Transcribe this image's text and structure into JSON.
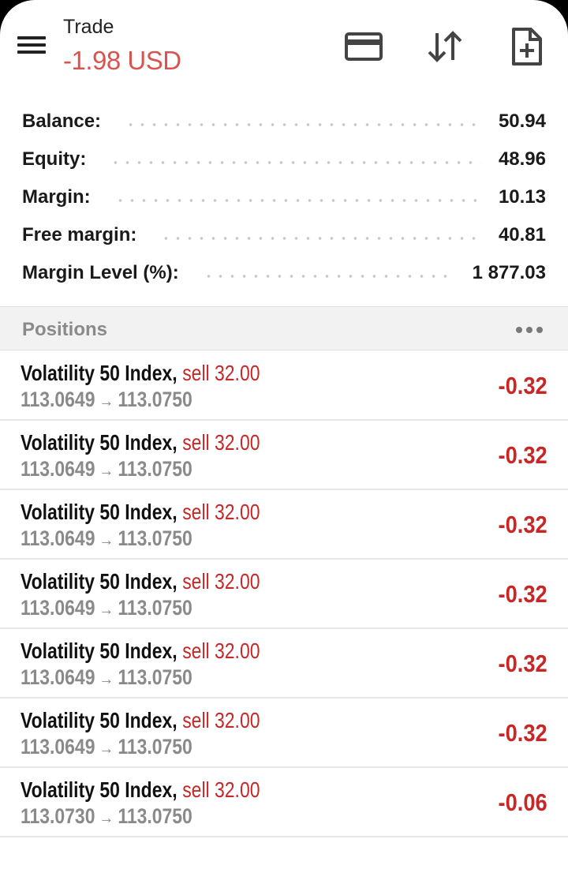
{
  "header": {
    "title": "Trade",
    "profit": "-1.98 USD",
    "icons": [
      "menu-icon",
      "card-icon",
      "sort-arrows-icon",
      "new-order-icon"
    ]
  },
  "colors": {
    "loss": "#c62828",
    "header_profit": "#d9534f",
    "muted": "#8a8a8a"
  },
  "summary": [
    {
      "label": "Balance:",
      "value": "50.94"
    },
    {
      "label": "Equity:",
      "value": "48.96"
    },
    {
      "label": "Margin:",
      "value": "10.13"
    },
    {
      "label": "Free margin:",
      "value": "40.81"
    },
    {
      "label": "Margin Level (%):",
      "value": "1 877.03"
    }
  ],
  "positions": {
    "title": "Positions",
    "items": [
      {
        "symbol": "Volatility 50 Index",
        "side": "sell 32.00",
        "open": "113.0649",
        "arrow": "→",
        "current": "113.0750",
        "profit": "-0.32"
      },
      {
        "symbol": "Volatility 50 Index",
        "side": "sell 32.00",
        "open": "113.0649",
        "arrow": "→",
        "current": "113.0750",
        "profit": "-0.32"
      },
      {
        "symbol": "Volatility 50 Index",
        "side": "sell 32.00",
        "open": "113.0649",
        "arrow": "→",
        "current": "113.0750",
        "profit": "-0.32"
      },
      {
        "symbol": "Volatility 50 Index",
        "side": "sell 32.00",
        "open": "113.0649",
        "arrow": "→",
        "current": "113.0750",
        "profit": "-0.32"
      },
      {
        "symbol": "Volatility 50 Index",
        "side": "sell 32.00",
        "open": "113.0649",
        "arrow": "→",
        "current": "113.0750",
        "profit": "-0.32"
      },
      {
        "symbol": "Volatility 50 Index",
        "side": "sell 32.00",
        "open": "113.0649",
        "arrow": "→",
        "current": "113.0750",
        "profit": "-0.32"
      },
      {
        "symbol": "Volatility 50 Index",
        "side": "sell 32.00",
        "open": "113.0730",
        "arrow": "→",
        "current": "113.0750",
        "profit": "-0.06"
      }
    ]
  }
}
